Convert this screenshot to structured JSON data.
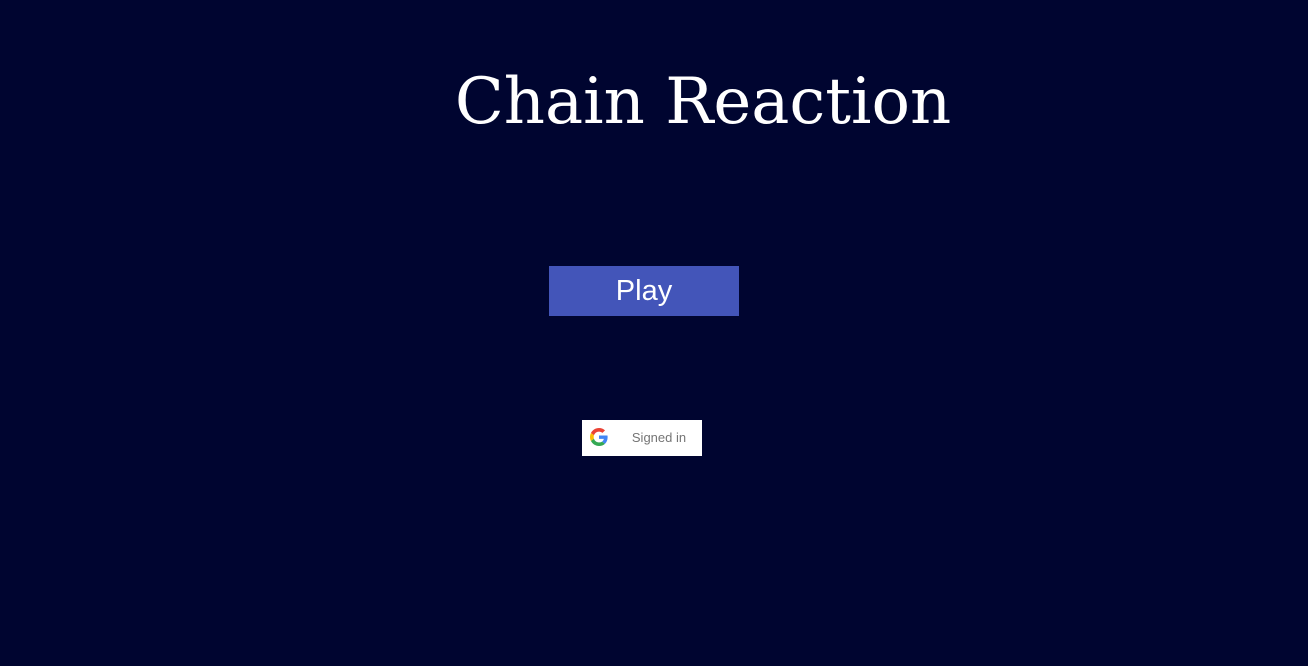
{
  "game": {
    "title": "Chain Reaction"
  },
  "menu": {
    "play_label": "Play"
  },
  "auth": {
    "provider_icon": "google-icon",
    "status_label": "Signed in"
  },
  "colors": {
    "background": "#000530",
    "play_button": "#4355b9",
    "title_text": "#ffffff",
    "signin_background": "#ffffff",
    "signin_text": "#757575"
  }
}
